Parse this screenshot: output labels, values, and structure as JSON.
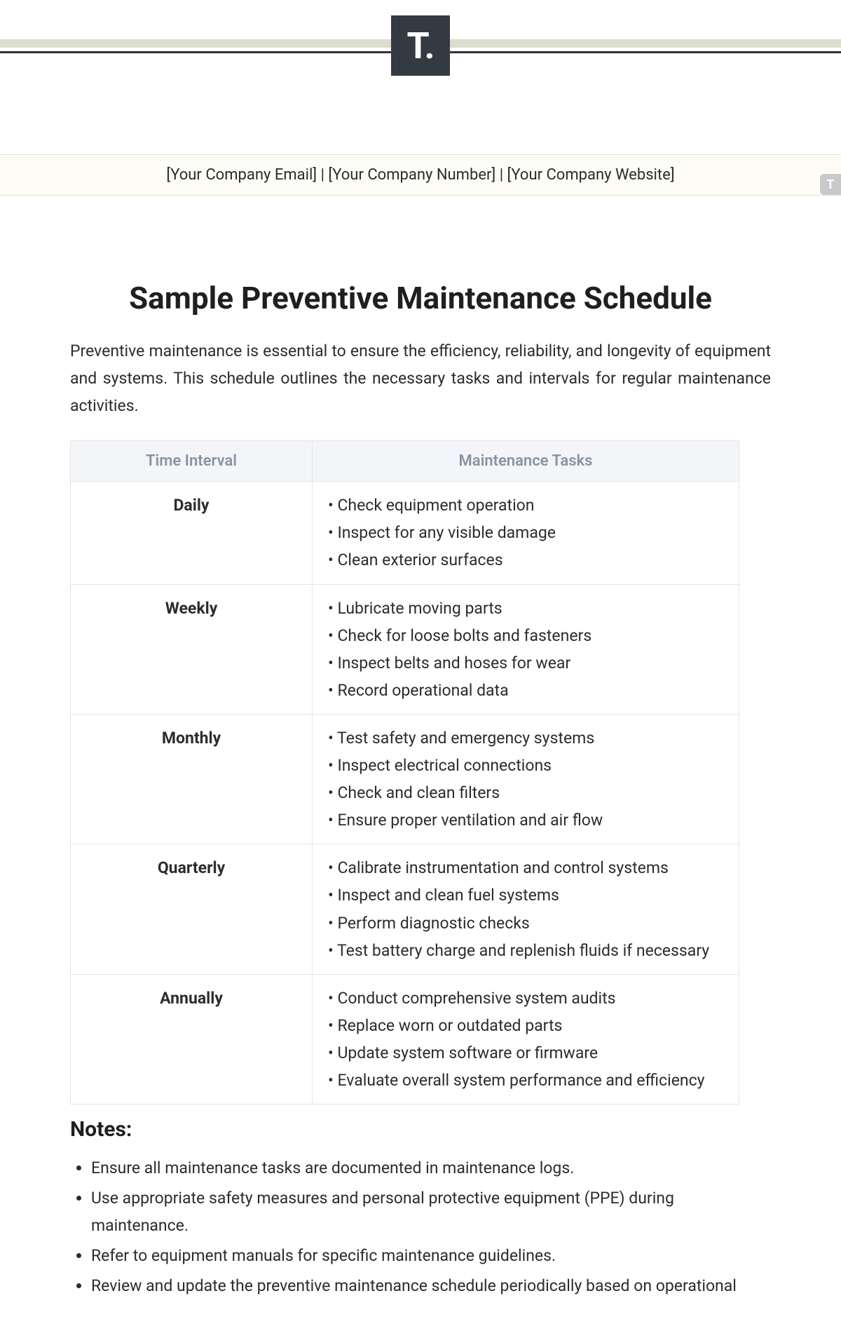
{
  "logo_text": "T.",
  "company_bar": "[Your Company Email] | [Your Company Number] | [Your Company Website]",
  "badge": "T",
  "title": "Sample Preventive Maintenance Schedule",
  "intro": "Preventive maintenance is essential to ensure the efficiency, reliability, and longevity of equipment and systems. This schedule outlines the necessary tasks and intervals for regular maintenance activities.",
  "table": {
    "headers": {
      "col1": "Time Interval",
      "col2": "Maintenance Tasks"
    },
    "rows": [
      {
        "interval": "Daily",
        "tasks": [
          "Check equipment operation",
          "Inspect for any visible damage",
          "Clean exterior surfaces"
        ]
      },
      {
        "interval": "Weekly",
        "tasks": [
          "Lubricate moving parts",
          "Check for loose bolts and fasteners",
          "Inspect belts and hoses for wear",
          "Record operational data"
        ]
      },
      {
        "interval": "Monthly",
        "tasks": [
          "Test safety and emergency systems",
          "Inspect electrical connections",
          "Check and clean filters",
          "Ensure proper ventilation and air flow"
        ]
      },
      {
        "interval": "Quarterly",
        "tasks": [
          "Calibrate instrumentation and control systems",
          "Inspect and clean fuel systems",
          "Perform diagnostic checks",
          "Test battery charge and replenish fluids if necessary"
        ]
      },
      {
        "interval": "Annually",
        "tasks": [
          "Conduct comprehensive system audits",
          "Replace worn or outdated parts",
          "Update system software or firmware",
          "Evaluate overall system performance and efficiency"
        ]
      }
    ]
  },
  "notes_heading": "Notes:",
  "notes": [
    "Ensure all maintenance tasks are documented in maintenance logs.",
    "Use appropriate safety measures and personal protective equipment (PPE) during maintenance.",
    "Refer to equipment manuals for specific maintenance guidelines.",
    "Review and update the preventive maintenance schedule periodically based on operational"
  ]
}
